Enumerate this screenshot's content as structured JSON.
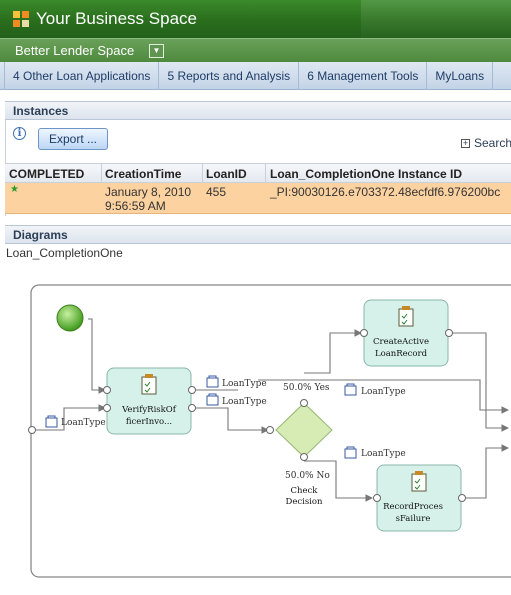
{
  "header": {
    "title": "Your Business Space"
  },
  "space": {
    "name": "Better Lender Space",
    "dropdown_icon": "chevron-down-icon"
  },
  "tabs": [
    {
      "label": "4 Other Loan Applications"
    },
    {
      "label": "5 Reports and Analysis"
    },
    {
      "label": "6 Management Tools"
    },
    {
      "label": "MyLoans"
    }
  ],
  "instances": {
    "title": "Instances",
    "export_label": "Export ...",
    "search_label": "Search",
    "columns": [
      "COMPLETED",
      "CreationTime",
      "LoanID",
      "Loan_CompletionOne Instance ID"
    ],
    "rows": [
      {
        "completed_icon": "star-icon",
        "creation_date": "January 8, 2010",
        "creation_time": "9:56:59 AM",
        "loan_id": "455",
        "instance_id": "_PI:90030126.e703372.48ecfdf6.976200bc"
      }
    ],
    "selected_row_color": "#fbd2a0"
  },
  "diagrams": {
    "title": "Diagrams",
    "process_name": "Loan_CompletionOne",
    "nodes": {
      "verify_line1": "VerifyRiskOf",
      "verify_line2": "ficerInvo...",
      "create_line1": "CreateActive",
      "create_line2": "LoanRecord",
      "record_line1": "RecordProces",
      "record_line2": "sFailure",
      "decision_line1": "Check",
      "decision_line2": "Decision"
    },
    "edge_labels": {
      "loantype": "LoanType",
      "yes": "50.0%  Yes",
      "no": "50.0%  No"
    },
    "colors": {
      "task_fill": "#d5f1ea",
      "task_stroke": "#8ab5a9",
      "decision_fill": "#d7ebb5",
      "start_fill": "#66c23a"
    }
  }
}
